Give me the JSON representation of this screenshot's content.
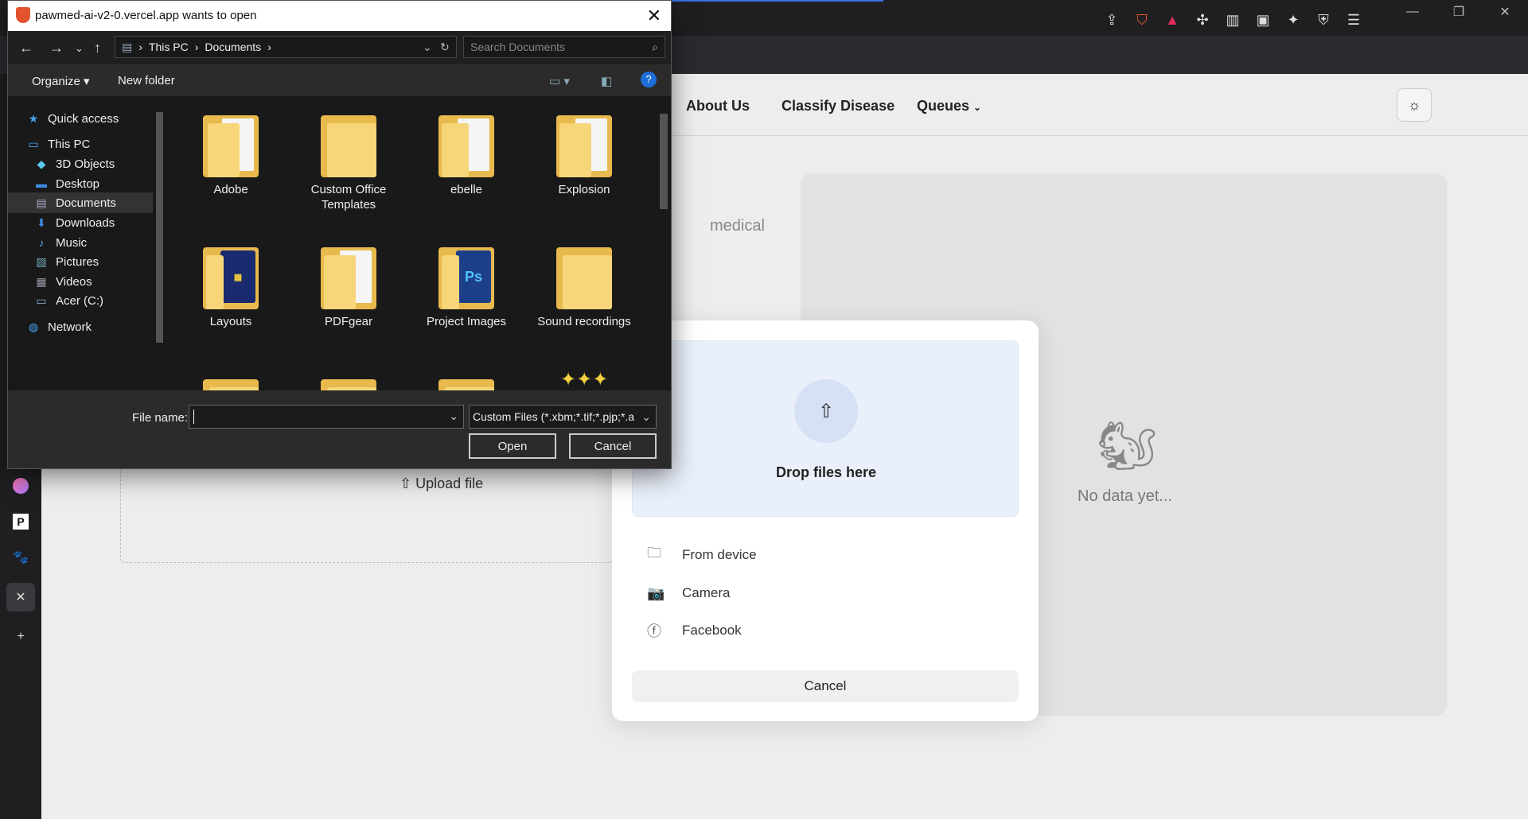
{
  "browser": {
    "window_controls": [
      "—",
      "❐",
      "✕"
    ],
    "toolbar_icons": [
      "share-icon",
      "brave-shield-icon",
      "rewards-icon",
      "extensions-icon",
      "sidebar-icon",
      "wallet-icon",
      "leo-icon",
      "vpn-icon",
      "menu-icon"
    ],
    "sidebar_icons": [
      "podcast-icon",
      "perplexity-icon",
      "paw-icon",
      "close-icon",
      "add-icon"
    ]
  },
  "site": {
    "nav": {
      "about": "About Us",
      "classify": "Classify Disease",
      "queues": "Queues"
    },
    "description_fragment": "medical",
    "upload_button": "Upload file",
    "no_data": "No data yet..."
  },
  "upload_modal": {
    "drop_label": "Drop files here",
    "sources": [
      {
        "label": "From device",
        "icon": "folder-icon"
      },
      {
        "label": "Camera",
        "icon": "camera-icon"
      },
      {
        "label": "Facebook",
        "icon": "facebook-icon"
      }
    ],
    "cancel": "Cancel"
  },
  "file_dialog": {
    "title": "pawmed-ai-v2-0.vercel.app wants to open",
    "breadcrumb": [
      "This PC",
      "Documents"
    ],
    "search_placeholder": "Search Documents",
    "organize": "Organize",
    "new_folder": "New folder",
    "nav_items": [
      {
        "label": "Quick access",
        "icon": "star-icon"
      },
      {
        "label": "This PC",
        "icon": "computer-icon"
      },
      {
        "label": "3D Objects",
        "icon": "cube-icon"
      },
      {
        "label": "Desktop",
        "icon": "desktop-icon"
      },
      {
        "label": "Documents",
        "icon": "document-icon",
        "selected": true
      },
      {
        "label": "Downloads",
        "icon": "download-icon"
      },
      {
        "label": "Music",
        "icon": "music-icon"
      },
      {
        "label": "Pictures",
        "icon": "pictures-icon"
      },
      {
        "label": "Videos",
        "icon": "videos-icon"
      },
      {
        "label": "Acer (C:)",
        "icon": "drive-icon"
      },
      {
        "label": "Network",
        "icon": "network-icon"
      }
    ],
    "files": [
      {
        "name": "Adobe"
      },
      {
        "name": "Custom Office Templates"
      },
      {
        "name": "ebelle"
      },
      {
        "name": "Explosion"
      },
      {
        "name": "Layouts"
      },
      {
        "name": "PDFgear"
      },
      {
        "name": "Project Images"
      },
      {
        "name": "Sound recordings"
      }
    ],
    "file_name_label": "File name:",
    "file_name_value": "",
    "file_type": "Custom Files (*.xbm;*.tif;*.pjp;*.a",
    "open": "Open",
    "cancel": "Cancel"
  }
}
